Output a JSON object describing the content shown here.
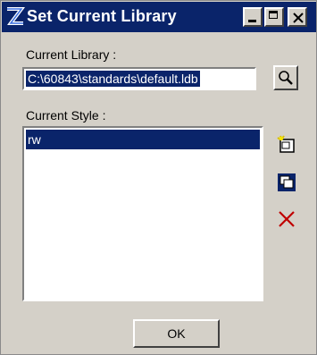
{
  "window": {
    "title": "Set Current Library",
    "icons": {
      "app": "app-logo-icon",
      "minimize": "minimize-icon",
      "maximize": "maximize-icon",
      "close": "close-icon"
    }
  },
  "library": {
    "label": "Current Library :",
    "value": "C:\\60843\\standards\\default.ldb",
    "browse_icon": "magnifier-icon"
  },
  "style": {
    "label": "Current Style :",
    "items": [
      {
        "label": "rw",
        "selected": true
      }
    ]
  },
  "side_buttons": [
    {
      "name": "new-style",
      "icon": "new-item-icon"
    },
    {
      "name": "copy-style",
      "icon": "copy-icon"
    },
    {
      "name": "delete-style",
      "icon": "delete-x-icon"
    }
  ],
  "ok_button": {
    "label": "OK"
  },
  "colors": {
    "titlebar": "#0a246a",
    "face": "#d4d0c8",
    "selection": "#0a246a",
    "delete_red": "#c00000"
  }
}
